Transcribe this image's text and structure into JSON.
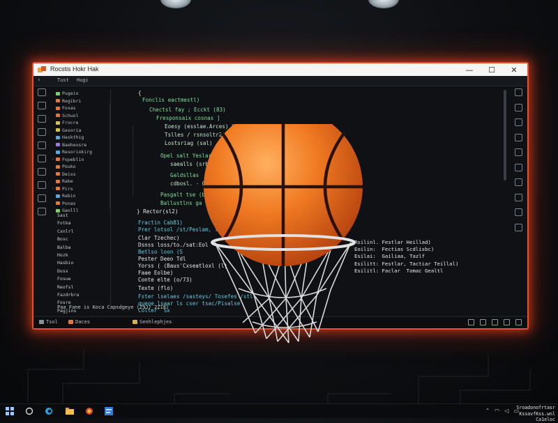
{
  "window": {
    "title": "Rocstis Hokr Hak",
    "controls": {
      "minimize": "—",
      "maximize": "☐",
      "close": "✕"
    }
  },
  "tabs": [
    {
      "label": "Tust"
    },
    {
      "label": "Hugi"
    }
  ],
  "explorer": {
    "items": [
      {
        "label": "Pugeio",
        "color": "#7fd06a"
      },
      {
        "label": "Regibri",
        "color": "#e07a3a"
      },
      {
        "label": "Foxas",
        "color": "#e07a3a"
      },
      {
        "label": "Schuol",
        "color": "#e07a3a"
      },
      {
        "label": "Frocre",
        "color": "#d5c24a"
      },
      {
        "label": "Gasoria",
        "color": "#d5c24a"
      },
      {
        "label": "Haskthig",
        "color": "#5aa8e0"
      },
      {
        "label": "Baeheusre",
        "color": "#9a7ce0"
      },
      {
        "label": "Resoriokirg",
        "color": "#5aa8e0"
      },
      {
        "label": "Fopeblin",
        "color": "#e07a3a"
      },
      {
        "label": "Pouko",
        "color": "#e07a3a"
      },
      {
        "label": "Deiss",
        "color": "#e07a3a"
      },
      {
        "label": "Rabe",
        "color": "#e07a3a"
      },
      {
        "label": "Pirs",
        "color": "#e07a3a"
      },
      {
        "label": "Rabin",
        "color": "#5aa8e0"
      },
      {
        "label": "Ponas",
        "color": "#e07a3a"
      },
      {
        "label": "Gaolll",
        "color": "#7fd06a"
      }
    ]
  },
  "outline": {
    "items": [
      {
        "label": "Sast"
      },
      {
        "label": "Fotka"
      },
      {
        "label": "Cxnlrl"
      },
      {
        "label": "Bosc"
      },
      {
        "label": "Balba"
      },
      {
        "label": "Hozk"
      },
      {
        "label": "Hasbio"
      },
      {
        "label": "Dosx"
      },
      {
        "label": "Fosue"
      },
      {
        "label": "Reofsl"
      },
      {
        "label": "Fazdrbra"
      },
      {
        "label": "Fosre"
      },
      {
        "label": "Pagjins"
      }
    ]
  },
  "editor": {
    "lines": [
      "{",
      "Fonclis eactmestl)",
      "Chectsl fay ; Ecckt (83)",
      "Fresponsaix cosnas ]",
      "Eoesy (esslae.Arces) Lj Tad)",
      "Tslles / rsnsoltr2) lalt)",
      "Lostsriag (sal)",
      "Opel salt Yeslar alst",
      "saealls (srbesst)",
      "Galdsllas",
      "cdbosl. - Gansi",
      "Pasgalt tse (bo Tl",
      "Ballustlns ga",
      "} Rector(sl2)",
      "Fractin Cab81)",
      "Prer lotsol /st/Peslam, Tal",
      "Clar Tzechec)",
      "Dsnss loss/to./sat:Eol",
      "Betlso loon (S",
      "Pester Deeo Tdl",
      "Yorss ( (Baus'Cxseatloxl (l)",
      "Faae Eolbe)",
      "Conte elte (o/73)",
      "Texte (flo)",
      "Fster lselaes /sasteys/ Tosefes /stl",
      "queoe lsaar ls cser tsac/Pisalse",
      "Colter' Sx"
    ]
  },
  "output": {
    "lines": [
      "Rsilinl. Festlar Heillad)",
      "Eoilin:  Fectias Scdlisbc)",
      "Esilai:  Gailiaa, Tazlf",
      "Esilitt: Festlar, Tactiar Teillal)",
      "Esilitl: Faclar  Tomac Gealtl"
    ]
  },
  "problems": {
    "text": "Paa Fane is Koca Capsdgeye (Z9J? 2Z18)"
  },
  "statusbar": {
    "left": "Tsol",
    "branch": "Daces",
    "file": "Senhlephjes"
  },
  "clock": {
    "line1": "Sroadonofrtasr",
    "line2": "KssavfKss.wnl",
    "line3": "Ca1eloc"
  },
  "colors": {
    "accent_glow": "#e8512a",
    "code_bg": "#0f1114",
    "ball": "#f07a22"
  }
}
